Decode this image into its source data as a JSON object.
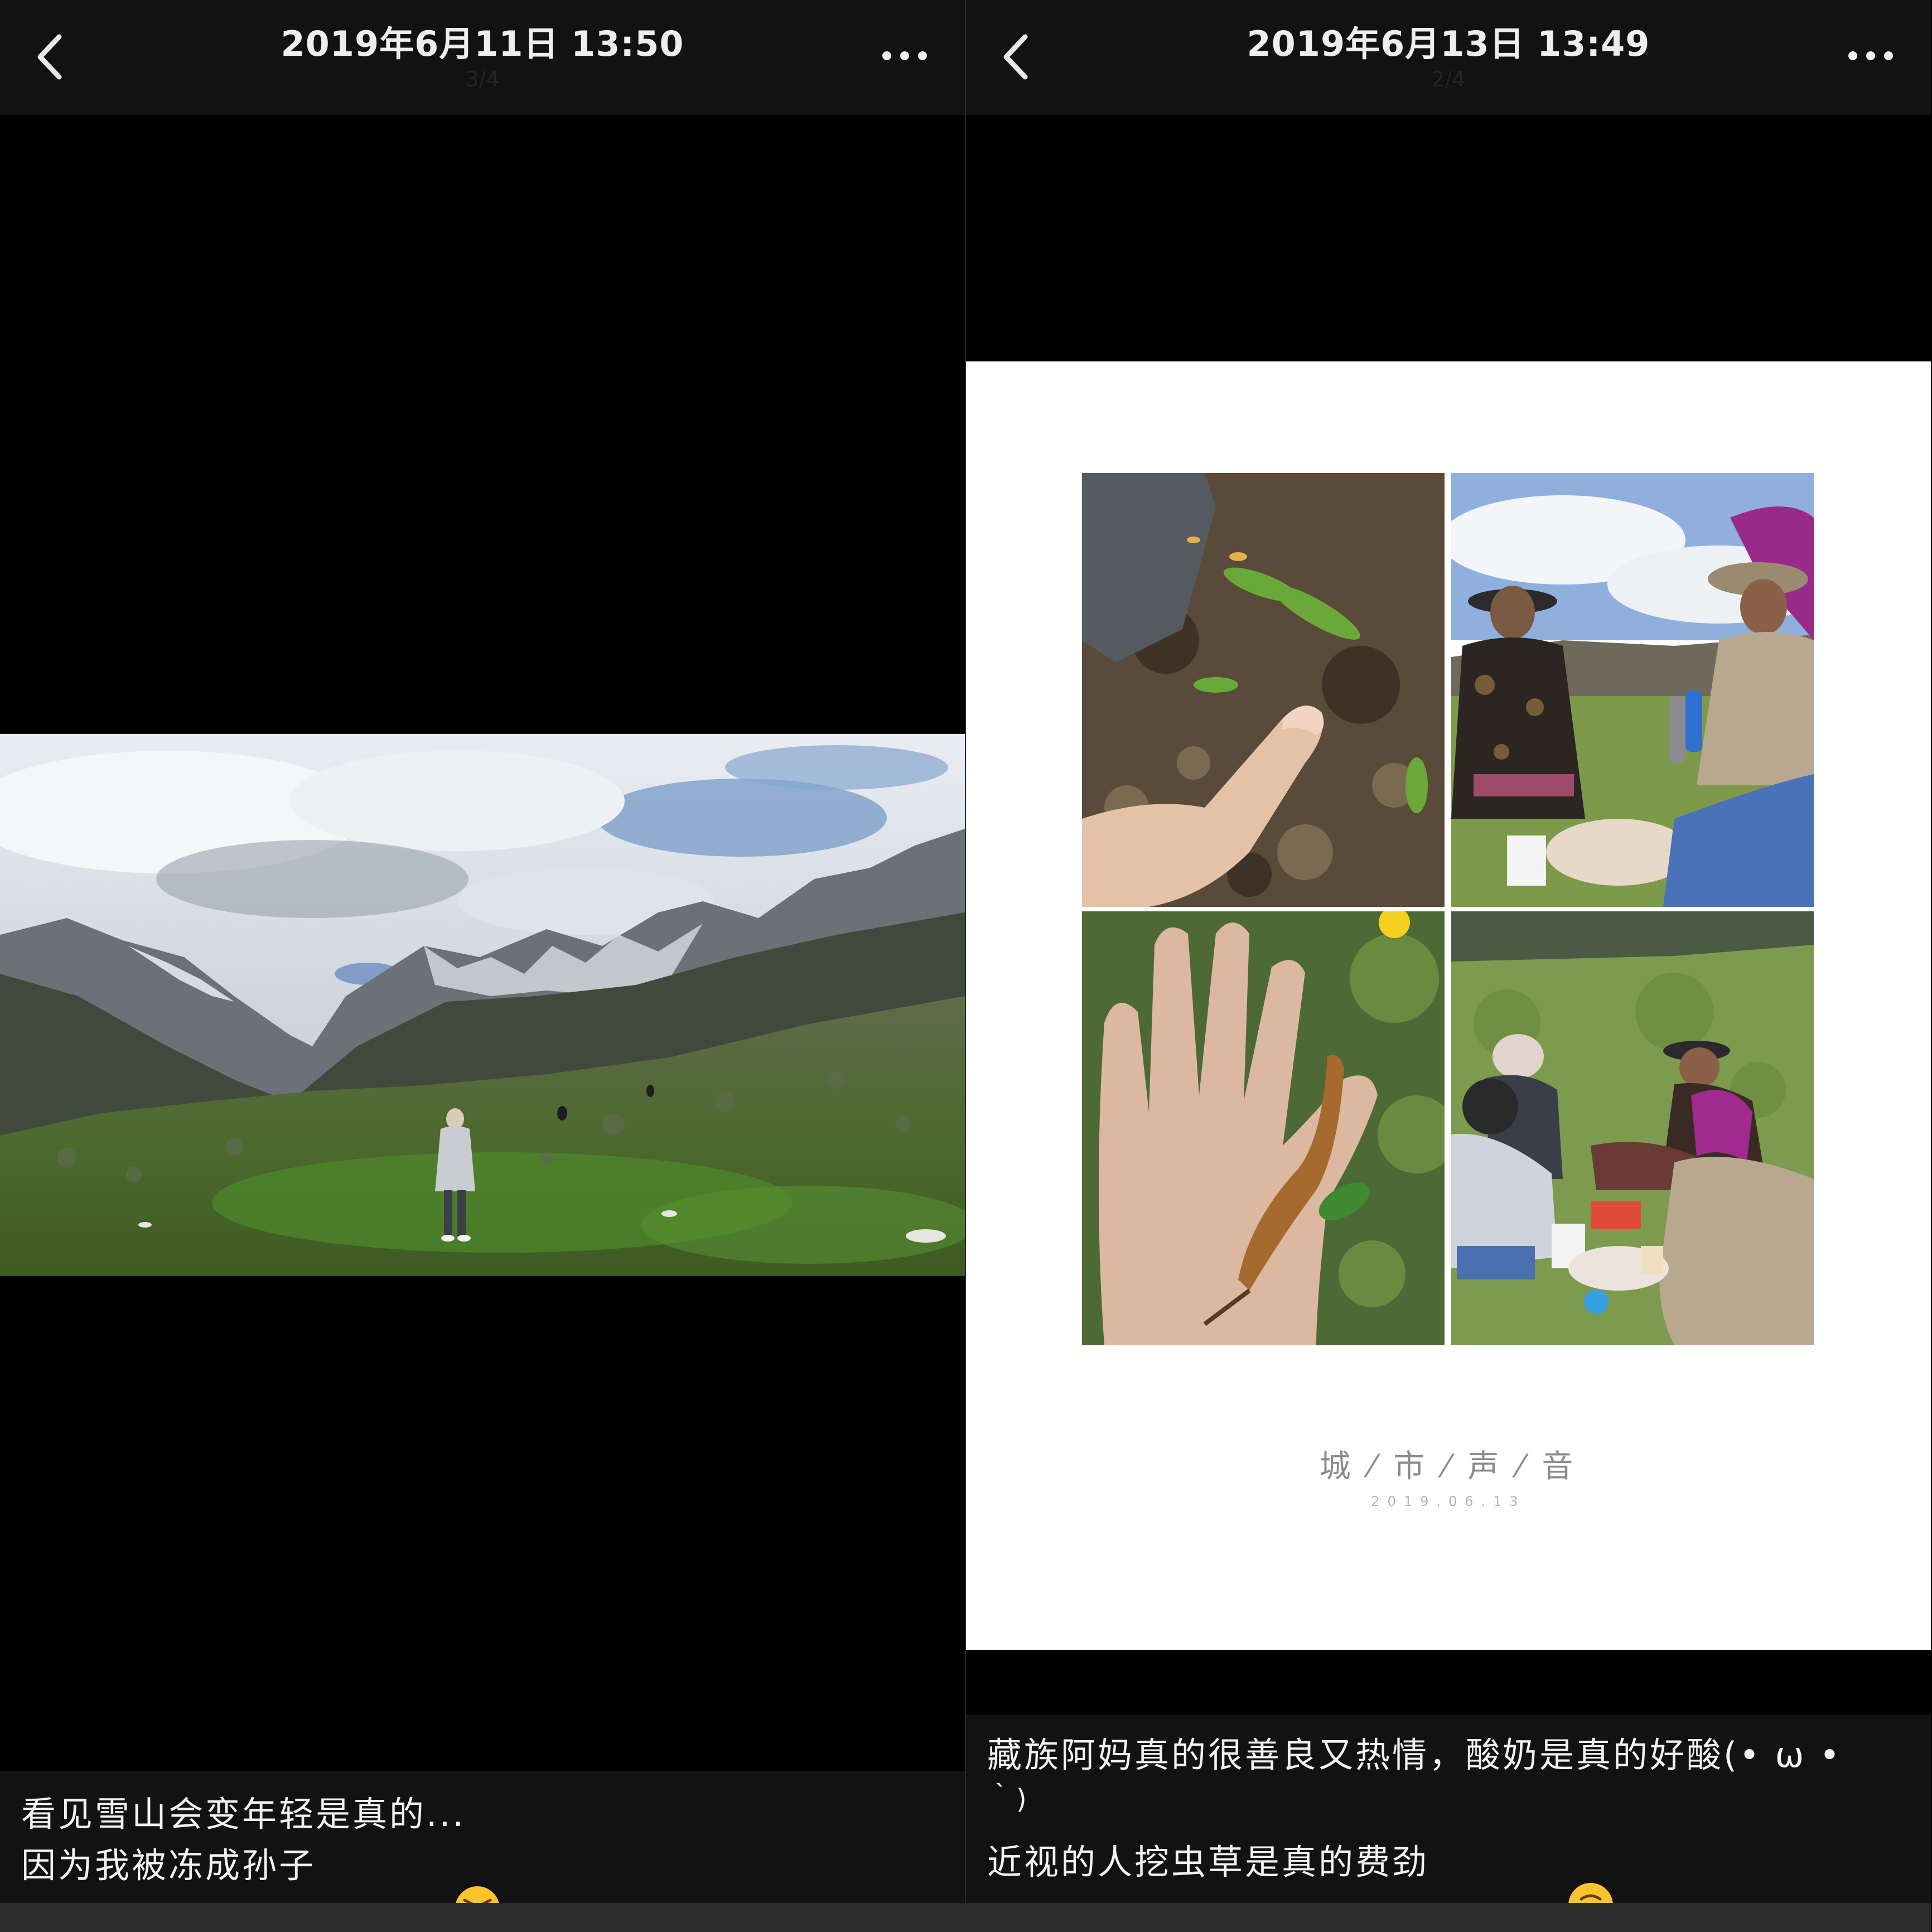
{
  "left_post": {
    "header": {
      "title": "2019年6月11日 13:50",
      "counter": "3/4"
    },
    "photo": {
      "description_icon": "mountain-landscape-photo"
    },
    "caption": {
      "line1": "看见雪山会变年轻是真的...",
      "line2": "因为我被冻成孙子",
      "emoji": "squinting-face-with-tongue"
    }
  },
  "right_post": {
    "header": {
      "title": "2019年6月13日 13:49",
      "counter": "2/4"
    },
    "card": {
      "heading": "城 ⁄ 市 ⁄ 声 ⁄ 音",
      "date": "2019.06.13"
    },
    "caption": {
      "line1": "藏族阿妈真的很善良又热情，酸奶是真的好酸(• ω •",
      "line2": "｀)",
      "line3": "近视的人挖虫草是真的费劲",
      "emoji": "upside-down-face"
    }
  },
  "colors": {
    "header_bg": "#121212",
    "page_bg": "#000000",
    "card_bg": "#ffffff",
    "text": "#f2f2f2"
  }
}
